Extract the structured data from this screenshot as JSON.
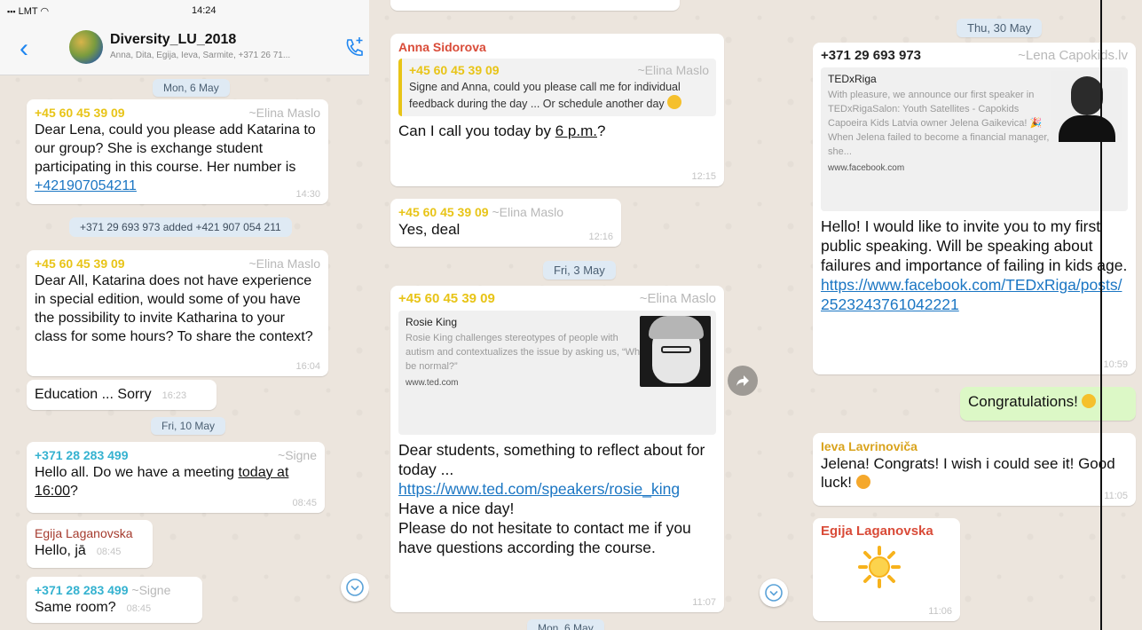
{
  "status_bar": {
    "carrier": "LMT",
    "time": "14:24"
  },
  "header": {
    "title": "Diversity_LU_2018",
    "members": "Anna, Dita, Egija, Ieva, Sarmite, +371 26 71..."
  },
  "colors": {
    "yellow_sender": "#e8c417",
    "blue_sender": "#35b2d0",
    "red_sender": "#d94b38",
    "link": "#1b76c3",
    "out_bubble": "#dcf8c6"
  },
  "panel1": {
    "date1": "Mon, 6 May",
    "msg1": {
      "sender": "+45 60 45 39 09",
      "alias": "~Elina Maslo",
      "text": "Dear Lena, could you please add Katarina to our group? She is exchange student participating in this course. Her number is ",
      "link": "+421907054211",
      "time": "14:30"
    },
    "system": "+371 29 693 973 added +421 907 054 211",
    "msg2": {
      "sender": "+45 60 45 39 09",
      "alias": "~Elina Maslo",
      "text": "Dear All, Katarina does not have experience  in special edition, would some of you have the possibility to invite Katharina to your class for some hours? To share the context?",
      "time": "16:04"
    },
    "msg3": {
      "text": "Education ... Sorry",
      "time": "16:23"
    },
    "date2": "Fri, 10 May",
    "msg4": {
      "sender": "+371 28 283 499",
      "alias": "~Signe",
      "text_a": "Hello all. Do we have a meeting ",
      "text_u1": "today at",
      "text_u2": "16:00",
      "text_b": "?",
      "time": "08:45"
    },
    "msg5": {
      "sender": "Egija Laganovska",
      "text": "Hello, jā",
      "time": "08:45"
    },
    "msg6": {
      "sender": "+371 28 283 499",
      "alias": "~Signe",
      "text": "Same room?",
      "time": "08:45"
    }
  },
  "panel2": {
    "msg1": {
      "sender": "Anna Sidorova",
      "quote_sender": "+45 60 45 39 09",
      "quote_alias": "~Elina Maslo",
      "quote_text": "Signe and Anna, could you please call me for individual feedback during the day ... Or schedule another day",
      "text_a": "Can I call you today by ",
      "text_u": "6 p.m.",
      "text_b": "?",
      "time": "12:15"
    },
    "msg2": {
      "sender": "+45 60 45 39 09",
      "alias": "~Elina Maslo",
      "text": "Yes, deal",
      "time": "12:16"
    },
    "date1": "Fri, 3 May",
    "msg3": {
      "sender": "+45 60 45 39 09",
      "alias": "~Elina Maslo",
      "preview_title": "Rosie King",
      "preview_desc": "Rosie King challenges stereotypes of people with autism and contextualizes the issue by asking us, “Why be normal?”",
      "preview_url": "www.ted.com",
      "text_a": "Dear students, something to reflect about for today ... ",
      "link": "https://www.ted.com/speakers/rosie_king",
      "text_b": "Have a nice day!",
      "text_c": "Please do not hesitate to contact me if you have questions according the course.",
      "time": "11:07"
    },
    "date2": "Mon, 6 May"
  },
  "panel3": {
    "date1": "Thu, 30 May",
    "msg1": {
      "sender": "+371 29 693 973",
      "alias": "~Lena Capokids.lv",
      "preview_title": "TEDxRiga",
      "preview_desc": "With pleasure, we announce our first speaker in TEDxRigaSalon: Youth Satellites - Capokids Capoeira Kids Latvia owner Jelena Gaikevica! 🎉 When Jelena failed to become a financial manager, she...",
      "preview_url": "www.facebook.com",
      "text": "Hello! I would like to invite you to my first public speaking. Will be speaking about failures and importance of failing in kids age. ",
      "link": "https://www.facebook.com/TEDxRiga/posts/2523243761042221",
      "time": "10:59"
    },
    "msg2": {
      "text": "Congratulations!"
    },
    "msg3": {
      "sender": "Ieva Lavrinoviča",
      "text": "Jelena! Congrats! I wish i could see it! Good luck!",
      "time": "11:05"
    },
    "msg4": {
      "sender": "Egija Laganovska",
      "time": "11:06"
    }
  }
}
